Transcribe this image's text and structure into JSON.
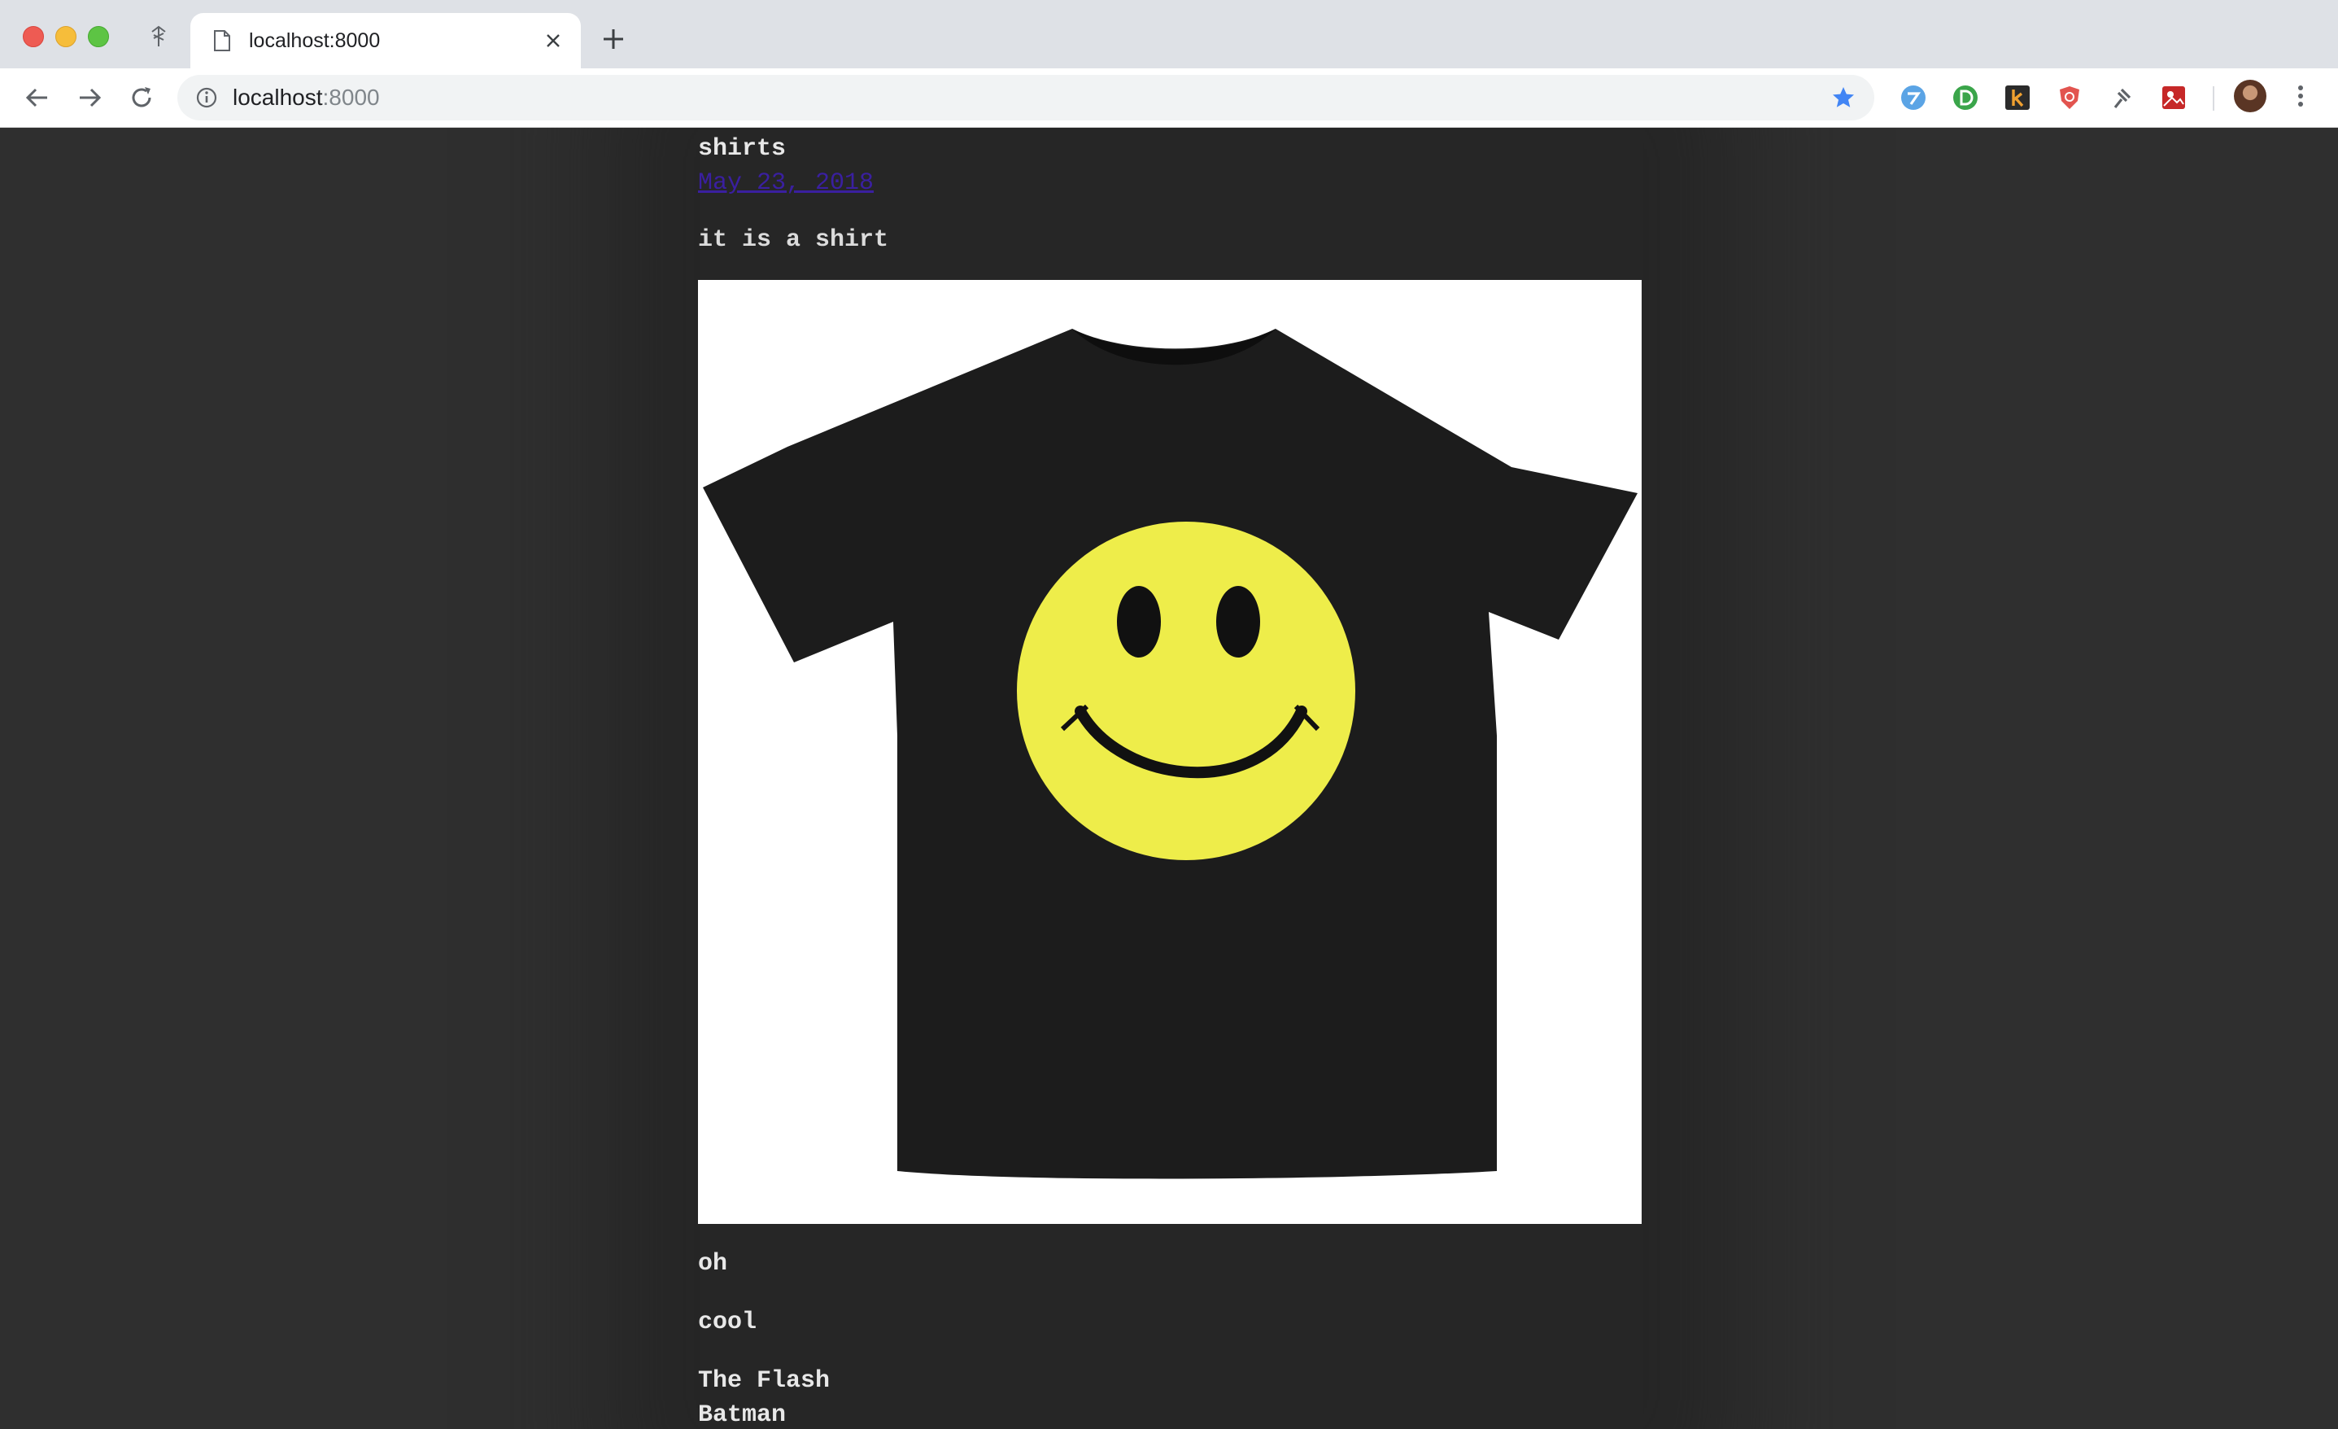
{
  "browser": {
    "tab_title": "localhost:8000",
    "url_host": "localhost",
    "url_port": ":8000"
  },
  "icons": {
    "tab_extra": "tab-search-icon",
    "tab_doc": "document-icon",
    "tab_close": "close-icon",
    "new_tab": "plus-icon",
    "back": "back-arrow-icon",
    "forward": "forward-arrow-icon",
    "reload": "reload-icon",
    "info": "info-icon",
    "bookmark": "star-icon",
    "extensions": [
      "extension-check-icon",
      "extension-d-icon",
      "extension-k-icon",
      "extension-shield-icon",
      "extension-pin-icon",
      "extension-photo-icon"
    ],
    "menu": "kebab-menu-icon"
  },
  "colors": {
    "page_bg": "#2f2f2f",
    "link": "#3a1fa0",
    "accent_star": "#4285f4"
  },
  "post": {
    "title": "shirts",
    "date": "May 23, 2018",
    "body": "it is a shirt",
    "image_subject": "black t-shirt with yellow smiley face",
    "paragraphs": [
      "oh",
      "cool"
    ],
    "list": [
      "The Flash",
      "Batman"
    ]
  }
}
